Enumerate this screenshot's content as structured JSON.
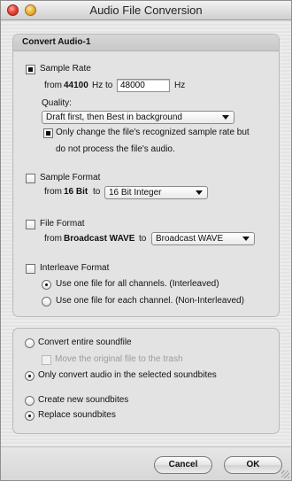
{
  "window": {
    "title": "Audio File Conversion"
  },
  "panel": {
    "title": "Convert Audio-1"
  },
  "sample_rate": {
    "checkbox_label": "Sample Rate",
    "checked": true,
    "from_prefix": "from",
    "from_value": "44100",
    "from_unit_to": "Hz to",
    "to_value": "48000",
    "to_unit": "Hz",
    "quality_label": "Quality:",
    "quality_selected": "Draft first, then Best in background",
    "only_change_line1": "Only change the file's recognized sample rate but",
    "only_change_line2": "do not process the file's audio.",
    "only_change_checked": true
  },
  "sample_format": {
    "checkbox_label": "Sample Format",
    "checked": false,
    "from_prefix": "from",
    "from_value": "16 Bit",
    "to_word": "to",
    "selected": "16 Bit Integer"
  },
  "file_format": {
    "checkbox_label": "File Format",
    "checked": false,
    "from_prefix": "from",
    "from_value": "Broadcast WAVE",
    "to_word": "to",
    "selected": "Broadcast WAVE"
  },
  "interleave": {
    "checkbox_label": "Interleave Format",
    "checked": false,
    "option_one": "Use one file for all channels. (Interleaved)",
    "option_two": "Use one file for each channel. (Non-Interleaved)",
    "selected_option": "option_one"
  },
  "scope": {
    "convert_entire": "Convert entire soundfile",
    "move_original": "Move the original file to the trash",
    "only_selected": "Only convert audio in the selected soundbites",
    "selected": "only_selected"
  },
  "soundbites": {
    "create_new": "Create new soundbites",
    "replace": "Replace soundbites",
    "selected": "replace"
  },
  "buttons": {
    "cancel": "Cancel",
    "ok": "OK"
  },
  "icons": {
    "close": "close-button-icon",
    "minimize": "minimize-button-icon",
    "popup_arrow": "chevron-down-icon",
    "resize": "resize-grip-icon"
  }
}
